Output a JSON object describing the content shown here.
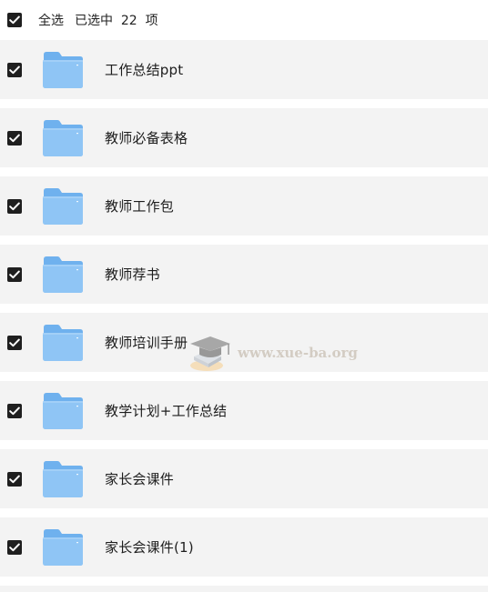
{
  "header": {
    "select_all_label": "全选",
    "selected_text": "已选中  22  项"
  },
  "items": [
    {
      "name": "工作总结ppt",
      "checked": true,
      "icon": "folder-icon"
    },
    {
      "name": "教师必备表格",
      "checked": true,
      "icon": "folder-icon"
    },
    {
      "name": "教师工作包",
      "checked": true,
      "icon": "folder-icon"
    },
    {
      "name": "教师荐书",
      "checked": true,
      "icon": "folder-icon"
    },
    {
      "name": "教师培训手册",
      "checked": true,
      "icon": "folder-icon"
    },
    {
      "name": "教学计划+工作总结",
      "checked": true,
      "icon": "folder-icon"
    },
    {
      "name": "家长会课件",
      "checked": true,
      "icon": "folder-icon"
    },
    {
      "name": "家长会课件(1)",
      "checked": true,
      "icon": "folder-icon"
    }
  ],
  "watermark": {
    "text": "www.xue-ba.org"
  },
  "colors": {
    "checkbox": "#1f1f1f",
    "row_background": "#f3f3f3",
    "folder_back": "#6fb1ee",
    "folder_front": "#8fc5f5"
  }
}
